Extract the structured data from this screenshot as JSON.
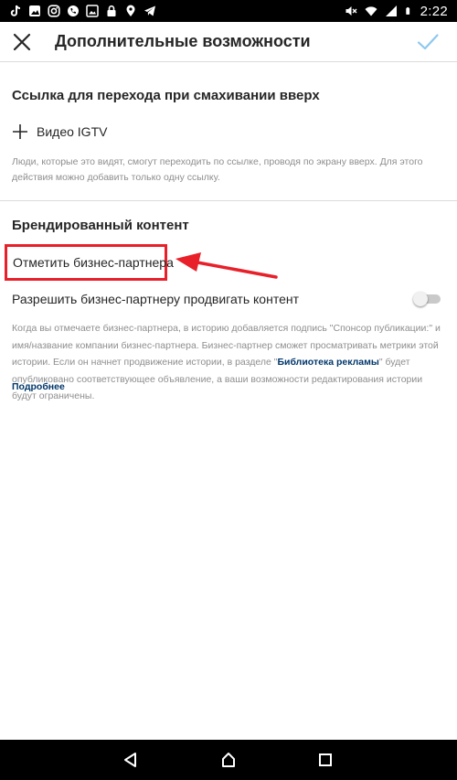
{
  "status_bar": {
    "time": "2:22",
    "icons_left": [
      "tiktok-icon",
      "gallery-icon",
      "instagram-icon",
      "phone-call-icon",
      "image-icon",
      "lock-icon",
      "location-icon",
      "telegram-icon"
    ],
    "icons_right": [
      "mute-icon",
      "wifi-icon",
      "signal-icon",
      "battery-icon"
    ]
  },
  "header": {
    "title": "Дополнительные возможности",
    "close_icon": "close-icon",
    "confirm_icon": "check-icon"
  },
  "swipe_link": {
    "title": "Ссылка для перехода при смахивании вверх",
    "add_label": "Видео IGTV",
    "description": "Люди, которые это видят, смогут переходить по ссылке, проводя по экрану вверх. Для этого действия можно добавить только одну ссылку."
  },
  "branded": {
    "title": "Брендированный контент",
    "tag_partner_label": "Отметить бизнес-партнера",
    "allow_promote_label": "Разрешить бизнес-партнеру продвигать контент",
    "allow_promote_enabled": false,
    "desc_part1": "Когда вы отмечаете бизнес-партнера, в историю добавляется подпись \"Спонсор публикации:\" и имя/название компании бизнес-партнера. Бизнес-партнер сможет просматривать метрики этой истории. Если он начнет продвижение истории, в разделе \"",
    "desc_link": "Библиотека рекламы",
    "desc_part2": "\" будет опубликовано соответствующее объявление, а ваши возможности редактирования истории будут ограничены.",
    "learn_more": "Подробнее"
  },
  "colors": {
    "highlight": "#e8202a",
    "link": "#00376b",
    "check": "#8ec8ef",
    "muted_text": "#8e8e8e"
  },
  "nav_bar": {
    "icons": [
      "back-icon",
      "home-icon",
      "recents-icon"
    ]
  }
}
